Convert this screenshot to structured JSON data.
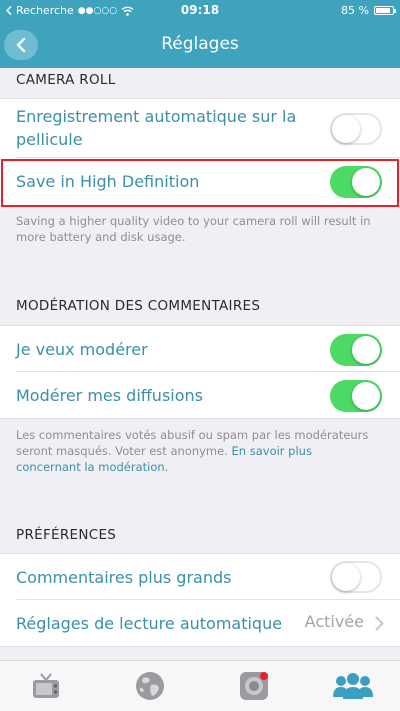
{
  "status_bar": {
    "carrier": "Recherche",
    "time": "09:18",
    "battery": "85 %",
    "battery_level": 0.85
  },
  "nav": {
    "title": "Réglages",
    "back_icon": "chevron-left-icon"
  },
  "camera_roll": {
    "header": "CAMERA ROLL",
    "auto_save_label_line1": "Enregistrement automatique sur la",
    "auto_save_label_line2": "pellicule",
    "auto_save_on": false,
    "hd_label": "Save in High Definition",
    "hd_on": true,
    "footnote_line1": "Saving a higher quality video to your camera roll will result in",
    "footnote_line2": "more battery and disk usage."
  },
  "moderation": {
    "header": "MODÉRATION DES COMMENTAIRES",
    "moderate_label": "Je veux modérer",
    "moderate_on": true,
    "moderate_broadcasts_label": "Modérer mes diffusions",
    "moderate_broadcasts_on": true,
    "footnote_line1": "Les commentaires votés abusif ou spam par les modérateurs",
    "footnote_line2_text": "seront masqués. Voter est anonyme. ",
    "footnote_line2_link": "En savoir plus",
    "footnote_line3_link": "concernant la modération."
  },
  "preferences": {
    "header": "PRÉFÉRENCES",
    "bigger_comments_label": "Commentaires plus grands",
    "bigger_comments_on": false,
    "autoplay_label": "Réglages de lecture automatique",
    "autoplay_value": "Activée"
  },
  "tab_bar": {
    "tabs": [
      {
        "icon": "tv-icon"
      },
      {
        "icon": "globe-icon"
      },
      {
        "icon": "camera-icon"
      },
      {
        "icon": "people-icon",
        "active": true
      }
    ]
  },
  "colors": {
    "accent": "#3fa3be",
    "toggle_on": "#4cd964",
    "link": "#3a90a8",
    "highlight": "#e8202a"
  }
}
